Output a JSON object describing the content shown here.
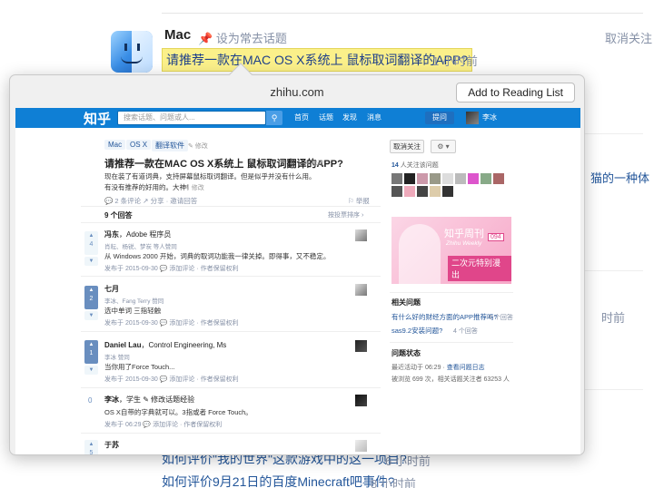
{
  "topic": {
    "name": "Mac",
    "set_common": "设为常去话题",
    "unfollow": "取消关注"
  },
  "highlight_question": {
    "title": "请推荐一款在MAC OS X系统上 鼠标取词翻译的APP?",
    "time": "1 小时前"
  },
  "background_fragments": {
    "right_text_1": "猫的一种体",
    "right_time_1": "时前"
  },
  "feed_bottom": [
    {
      "title": "如何评价\"我的世界\"这款游戏中的这一项目?",
      "time": "6 小时前"
    },
    {
      "title": "如何评价9月21日的百度Minecraft吧事件?",
      "time": "8 小时前"
    }
  ],
  "popover": {
    "domain": "zhihu.com",
    "reading_list_button": "Add to Reading List"
  },
  "zhihu": {
    "logo": "知乎",
    "search_placeholder": "搜索话题、问题或人...",
    "search_icon": "search-icon",
    "nav": [
      "首页",
      "话题",
      "发现",
      "消息"
    ],
    "ask": "提问",
    "user": "李冰",
    "tags": [
      "Mac",
      "OS X",
      "翻译软件"
    ],
    "tag_edit": "✎ 修改",
    "question": "请推荐一款在MAC OS X系统上 鼠标取词翻译的APP?",
    "question_edit": "✎ 修改",
    "description_1": "现在装了有道词典，支持屏幕鼠标取词翻译。但是似乎并没有什么用。",
    "description_2": "有没有推荐的好用的。大神！",
    "description_edit": "✎ 修改",
    "q_actions": "💬 2 条评论   ↗ 分享 · 邀请回答",
    "report": "⚐ 举报",
    "answer_count": "9 个回答",
    "sort": "按投票排序 ›",
    "answers": [
      {
        "votes": "4",
        "author": "冯东",
        "bio": "，Adobe 程序员",
        "voters": "肖耘、杨锐、梦炭 等人赞同",
        "body": "从 Windows 2000 开始，词典的取词功能我一律关掉。即得事，又不稳定。",
        "foot": "发布于 2015-09-30   💬 添加评论  · 作者保留权利"
      },
      {
        "votes": "2",
        "author": "七月",
        "bio": "",
        "voters": "李冰、Fang Terry 赞同",
        "body": "选中单词 三指轻触",
        "foot": "发布于 2015-09-30   💬 添加评论  · 作者保留权利"
      },
      {
        "votes": "1",
        "author": "Daniel Lau",
        "bio": "，Control Engineering, Ms",
        "voters": "李冰 赞同",
        "body": "当你用了Force Touch...",
        "foot": "发布于 2015-09-30   💬 添加评论  · 作者保留权利"
      },
      {
        "votes": "0",
        "author": "李冰",
        "bio": "，学生   ✎ 修改话题经验",
        "voters": "",
        "body": "OS X自带的字典就可以。3指或者 Force Touch。",
        "foot": "发布于 06:29   💬 添加评论  · 作者保留权利"
      },
      {
        "votes": "5",
        "author": "于苏",
        "bio": "",
        "voters": "",
        "body": "",
        "foot": ""
      }
    ],
    "sidebar": {
      "unfollow": "取消关注",
      "gear": "⚙ ▾",
      "followers_count": "14",
      "followers_label": " 人关注该问题",
      "banner_title": "知乎周刊",
      "banner_sub": "Zhihu Weekly",
      "banner_num": "094",
      "banner_slogan": "二次元特别漫出",
      "related_head": "相关问题",
      "related": [
        {
          "title": "有什么好的财经方面的APP推荐吗?",
          "count": "6 个回答"
        },
        {
          "title": "sas9.2安装问题?",
          "count": "4 个回答"
        }
      ],
      "status_head": "问题状态",
      "status_line1_a": "最近活动于 06:29 · ",
      "status_line1_b": "查看问题日志",
      "status_line2": "被浏览 699 次，相关话题关注者 63253 人"
    }
  }
}
